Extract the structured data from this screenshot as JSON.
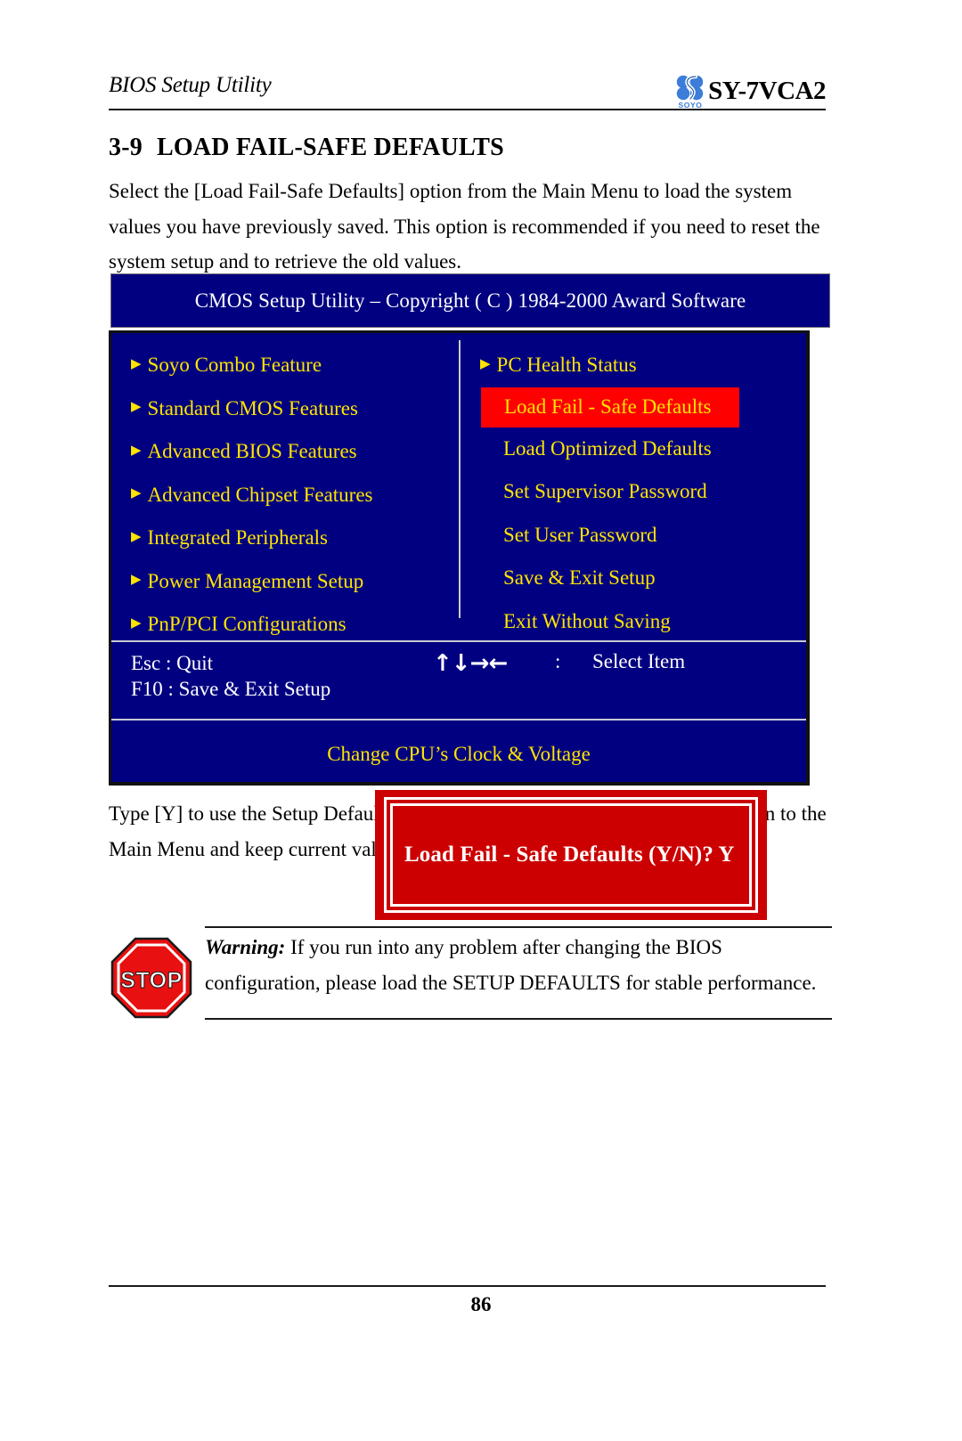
{
  "document": {
    "header_title": "BIOS Setup Utility",
    "model": "SY-7VCA2",
    "logo_wordmark": "SOYO",
    "page_number": "86"
  },
  "section": {
    "number": "3-9",
    "title": "LOAD FAIL-SAFE DEFAULTS",
    "intro": "Select the [Load Fail-Safe Defaults] option from the Main Menu to load the system values you have previously saved. This option is recommended if you need to reset the system setup and to retrieve the old values.",
    "after_figure": "Type [Y] to use the Setup Defaults followed by [Enter] or otherwise [N] to return to the Main Menu and keep current values."
  },
  "bios": {
    "titlebar": "CMOS Setup Utility – Copyright ( C ) 1984-2000 Award Software",
    "left_menu": [
      {
        "label": "Soyo Combo Feature",
        "arrow": true
      },
      {
        "label": "Standard CMOS Features",
        "arrow": true
      },
      {
        "label": "Advanced BIOS Features",
        "arrow": true
      },
      {
        "label": "Advanced Chipset Features",
        "arrow": true
      },
      {
        "label": "Integrated Peripherals",
        "arrow": true
      },
      {
        "label": "Power Management Setup",
        "arrow": true
      },
      {
        "label": "PnP/PCI Configurations",
        "arrow": true
      }
    ],
    "right_menu": [
      {
        "label": "PC Health Status",
        "arrow": true,
        "highlight": false
      },
      {
        "label": "Load Fail - Safe Defaults",
        "arrow": false,
        "highlight": true
      },
      {
        "label": "Load Optimized Defaults",
        "arrow": false,
        "highlight": false
      },
      {
        "label": "Set Supervisor Password",
        "arrow": false,
        "highlight": false
      },
      {
        "label": "Set User Password",
        "arrow": false,
        "highlight": false
      },
      {
        "label": "Save & Exit Setup",
        "arrow": false,
        "highlight": false
      },
      {
        "label": "Exit Without Saving",
        "arrow": false,
        "highlight": false
      }
    ],
    "hints": {
      "quit": "Esc : Quit",
      "save_exit": "F10 : Save & Exit Setup",
      "arrows": "↑↓→←",
      "separator": ":",
      "select_item": "Select Item"
    },
    "caption": "Change CPU’s Clock & Voltage",
    "dialog": {
      "message": "Load Fail - Safe Defaults (Y/N)? Y"
    },
    "colors": {
      "screen_blue": "#000080",
      "menu_yellow": "#ffe400",
      "highlight_red": "#ff0000",
      "dialog_red": "#cc0000",
      "text_white": "#ffffff"
    }
  },
  "note": {
    "warning_label": "Warning:",
    "body": " If you run into any problem after changing the BIOS configuration, please load the SETUP DEFAULTS for stable performance.",
    "icon_label": "STOP",
    "icon_color": "#e81010"
  }
}
